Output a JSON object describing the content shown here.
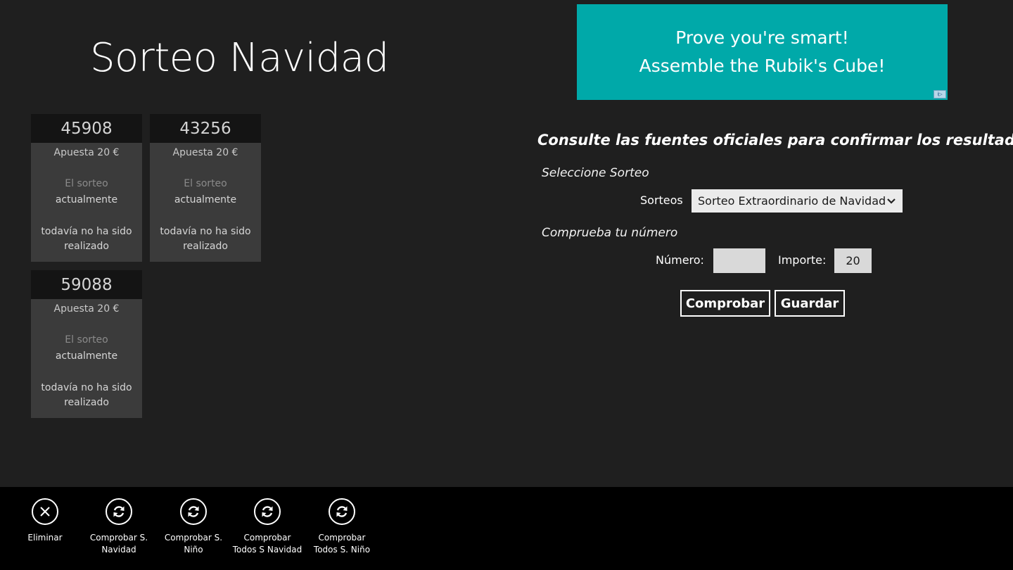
{
  "page": {
    "title": "Sorteo Navidad"
  },
  "tickets": [
    {
      "number": "45908",
      "bet": "Apuesta  20 €",
      "status_line1": "El sorteo",
      "status_line2": "actualmente",
      "status_line3": "todavía no ha sido realizado"
    },
    {
      "number": "43256",
      "bet": "Apuesta  20 €",
      "status_line1": "El sorteo",
      "status_line2": "actualmente",
      "status_line3": "todavía no ha sido realizado"
    },
    {
      "number": "59088",
      "bet": "Apuesta  20 €",
      "status_line1": "El sorteo",
      "status_line2": "actualmente",
      "status_line3": "todavía no ha sido realizado"
    }
  ],
  "ad": {
    "line1": "Prove you're smart!",
    "line2": "Assemble the Rubik's Cube!",
    "badge": "i▷",
    "color": "#00a9a9"
  },
  "form": {
    "notice": "Consulte las fuentes oficiales para confirmar los resultados",
    "select_section": "Seleccione Sorteo",
    "sorteos_label": "Sorteos",
    "sorteo_selected": "Sorteo Extraordinario de Navidad",
    "check_section": "Comprueba tu número",
    "numero_label": "Número:",
    "numero_value": "",
    "importe_label": "Importe:",
    "importe_value": "20",
    "check_button": "Comprobar",
    "save_button": "Guardar"
  },
  "appbar": {
    "items": [
      {
        "label": "Eliminar",
        "icon": "close-icon"
      },
      {
        "label": "Comprobar S.\nNavidad",
        "icon": "refresh-icon"
      },
      {
        "label": "Comprobar S.\nNiño",
        "icon": "refresh-icon"
      },
      {
        "label": "Comprobar\nTodos S Navidad",
        "icon": "refresh-icon"
      },
      {
        "label": "Comprobar\nTodos S. Niño",
        "icon": "refresh-icon"
      }
    ]
  }
}
